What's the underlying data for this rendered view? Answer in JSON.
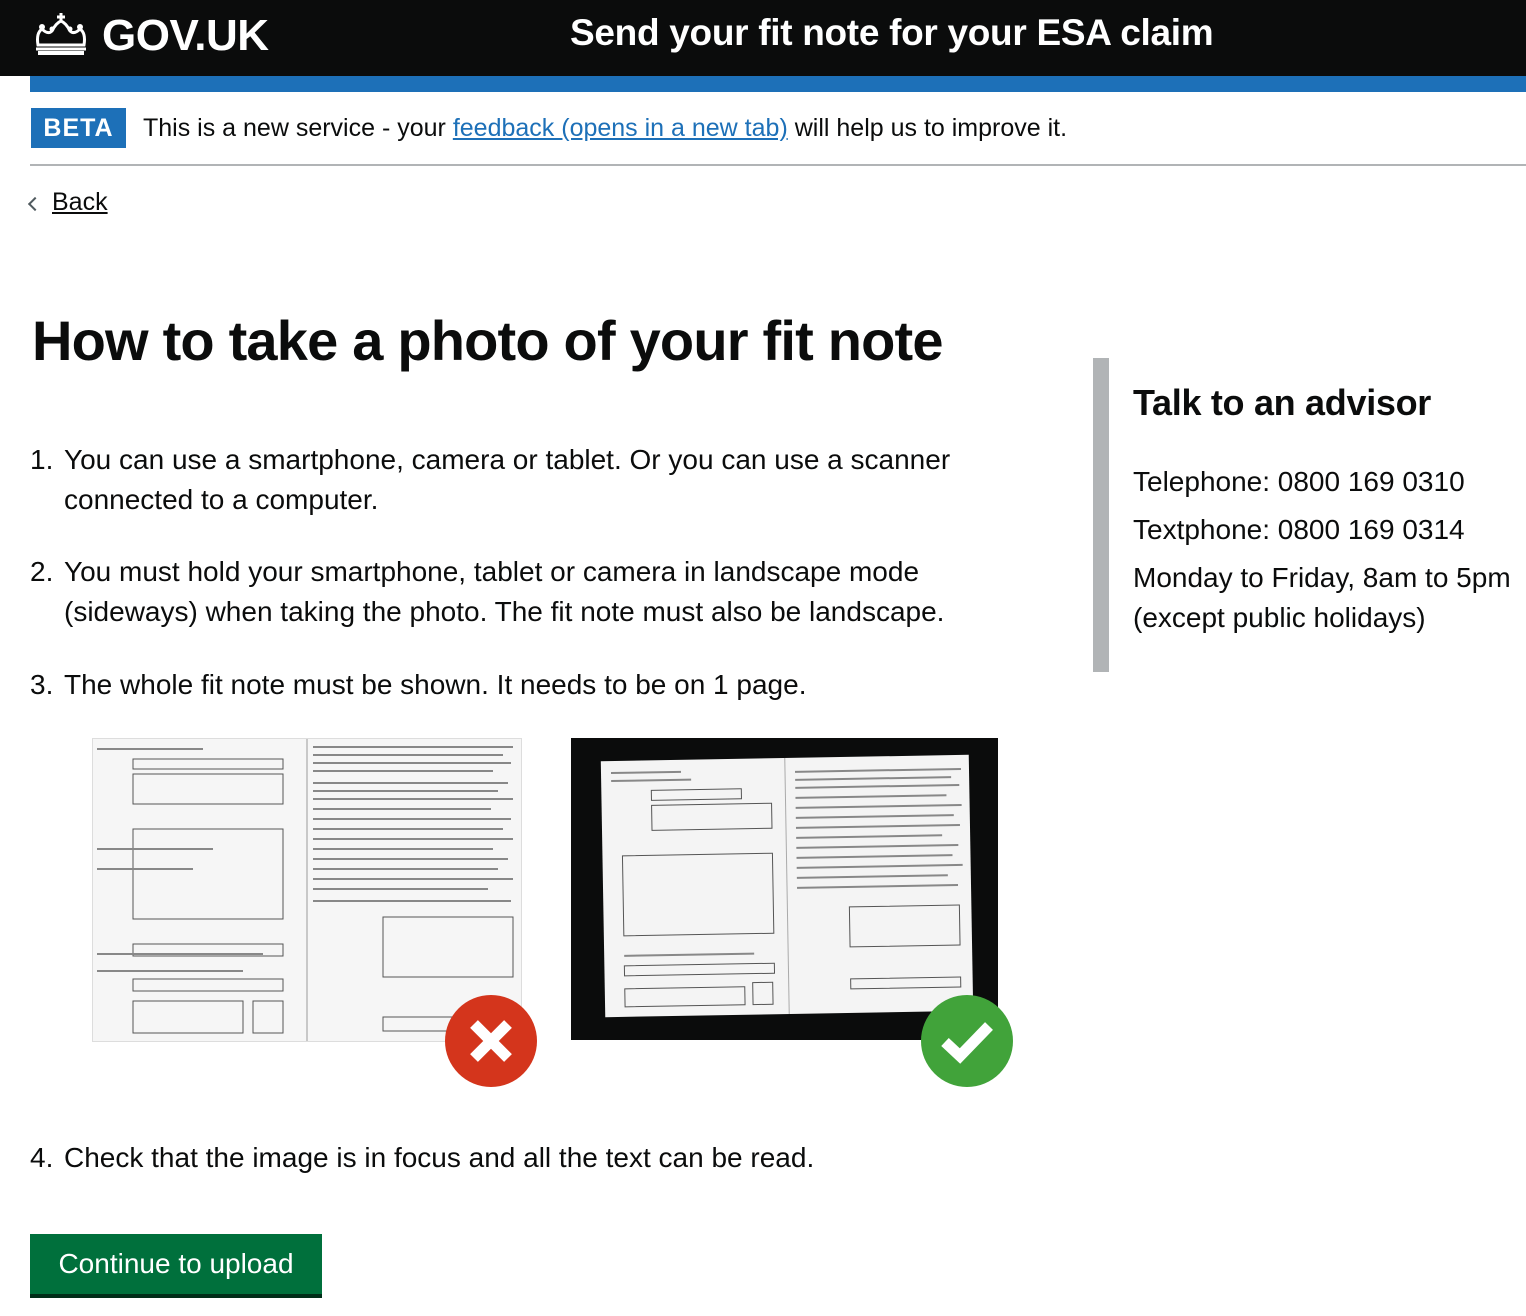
{
  "header": {
    "logo_text": "GOV.UK",
    "service_name": "Send your fit note for your ESA claim"
  },
  "phase_banner": {
    "tag": "BETA",
    "text_before": "This is a new service - your",
    "link_text": "feedback (opens in a new tab)",
    "text_after": "will help us to improve it."
  },
  "back_link": "Back",
  "title": "How to take a photo of your fit note",
  "steps": [
    {
      "num": "1.",
      "text": "You can use a smartphone, camera or tablet. Or you can use a scanner connected to a computer."
    },
    {
      "num": "2.",
      "text": "You must hold your smartphone, tablet or camera in landscape mode (sideways) when taking the photo. The fit note must also be landscape."
    },
    {
      "num": "3.",
      "text": "The whole fit note must be shown. It needs to be on 1 page."
    },
    {
      "num": "4.",
      "text": "Check that the image is in focus and all the text can be read."
    }
  ],
  "continue_button": "Continue to upload",
  "aside": {
    "title": "Talk to an advisor",
    "telephone": "Telephone: 0800 169 0310",
    "textphone": "Textphone: 0800 169 0314",
    "hours": "Monday to Friday, 8am to 5pm",
    "hours_note": "(except public holidays)"
  },
  "colors": {
    "header_bg": "#0b0c0c",
    "brand_blue": "#1d70b8",
    "button_green": "#00703c",
    "wrong_red": "#d4351c",
    "right_green": "#41a33a"
  },
  "icons": [
    "crown-icon",
    "chevron-left-icon",
    "cross-icon",
    "tick-icon"
  ]
}
